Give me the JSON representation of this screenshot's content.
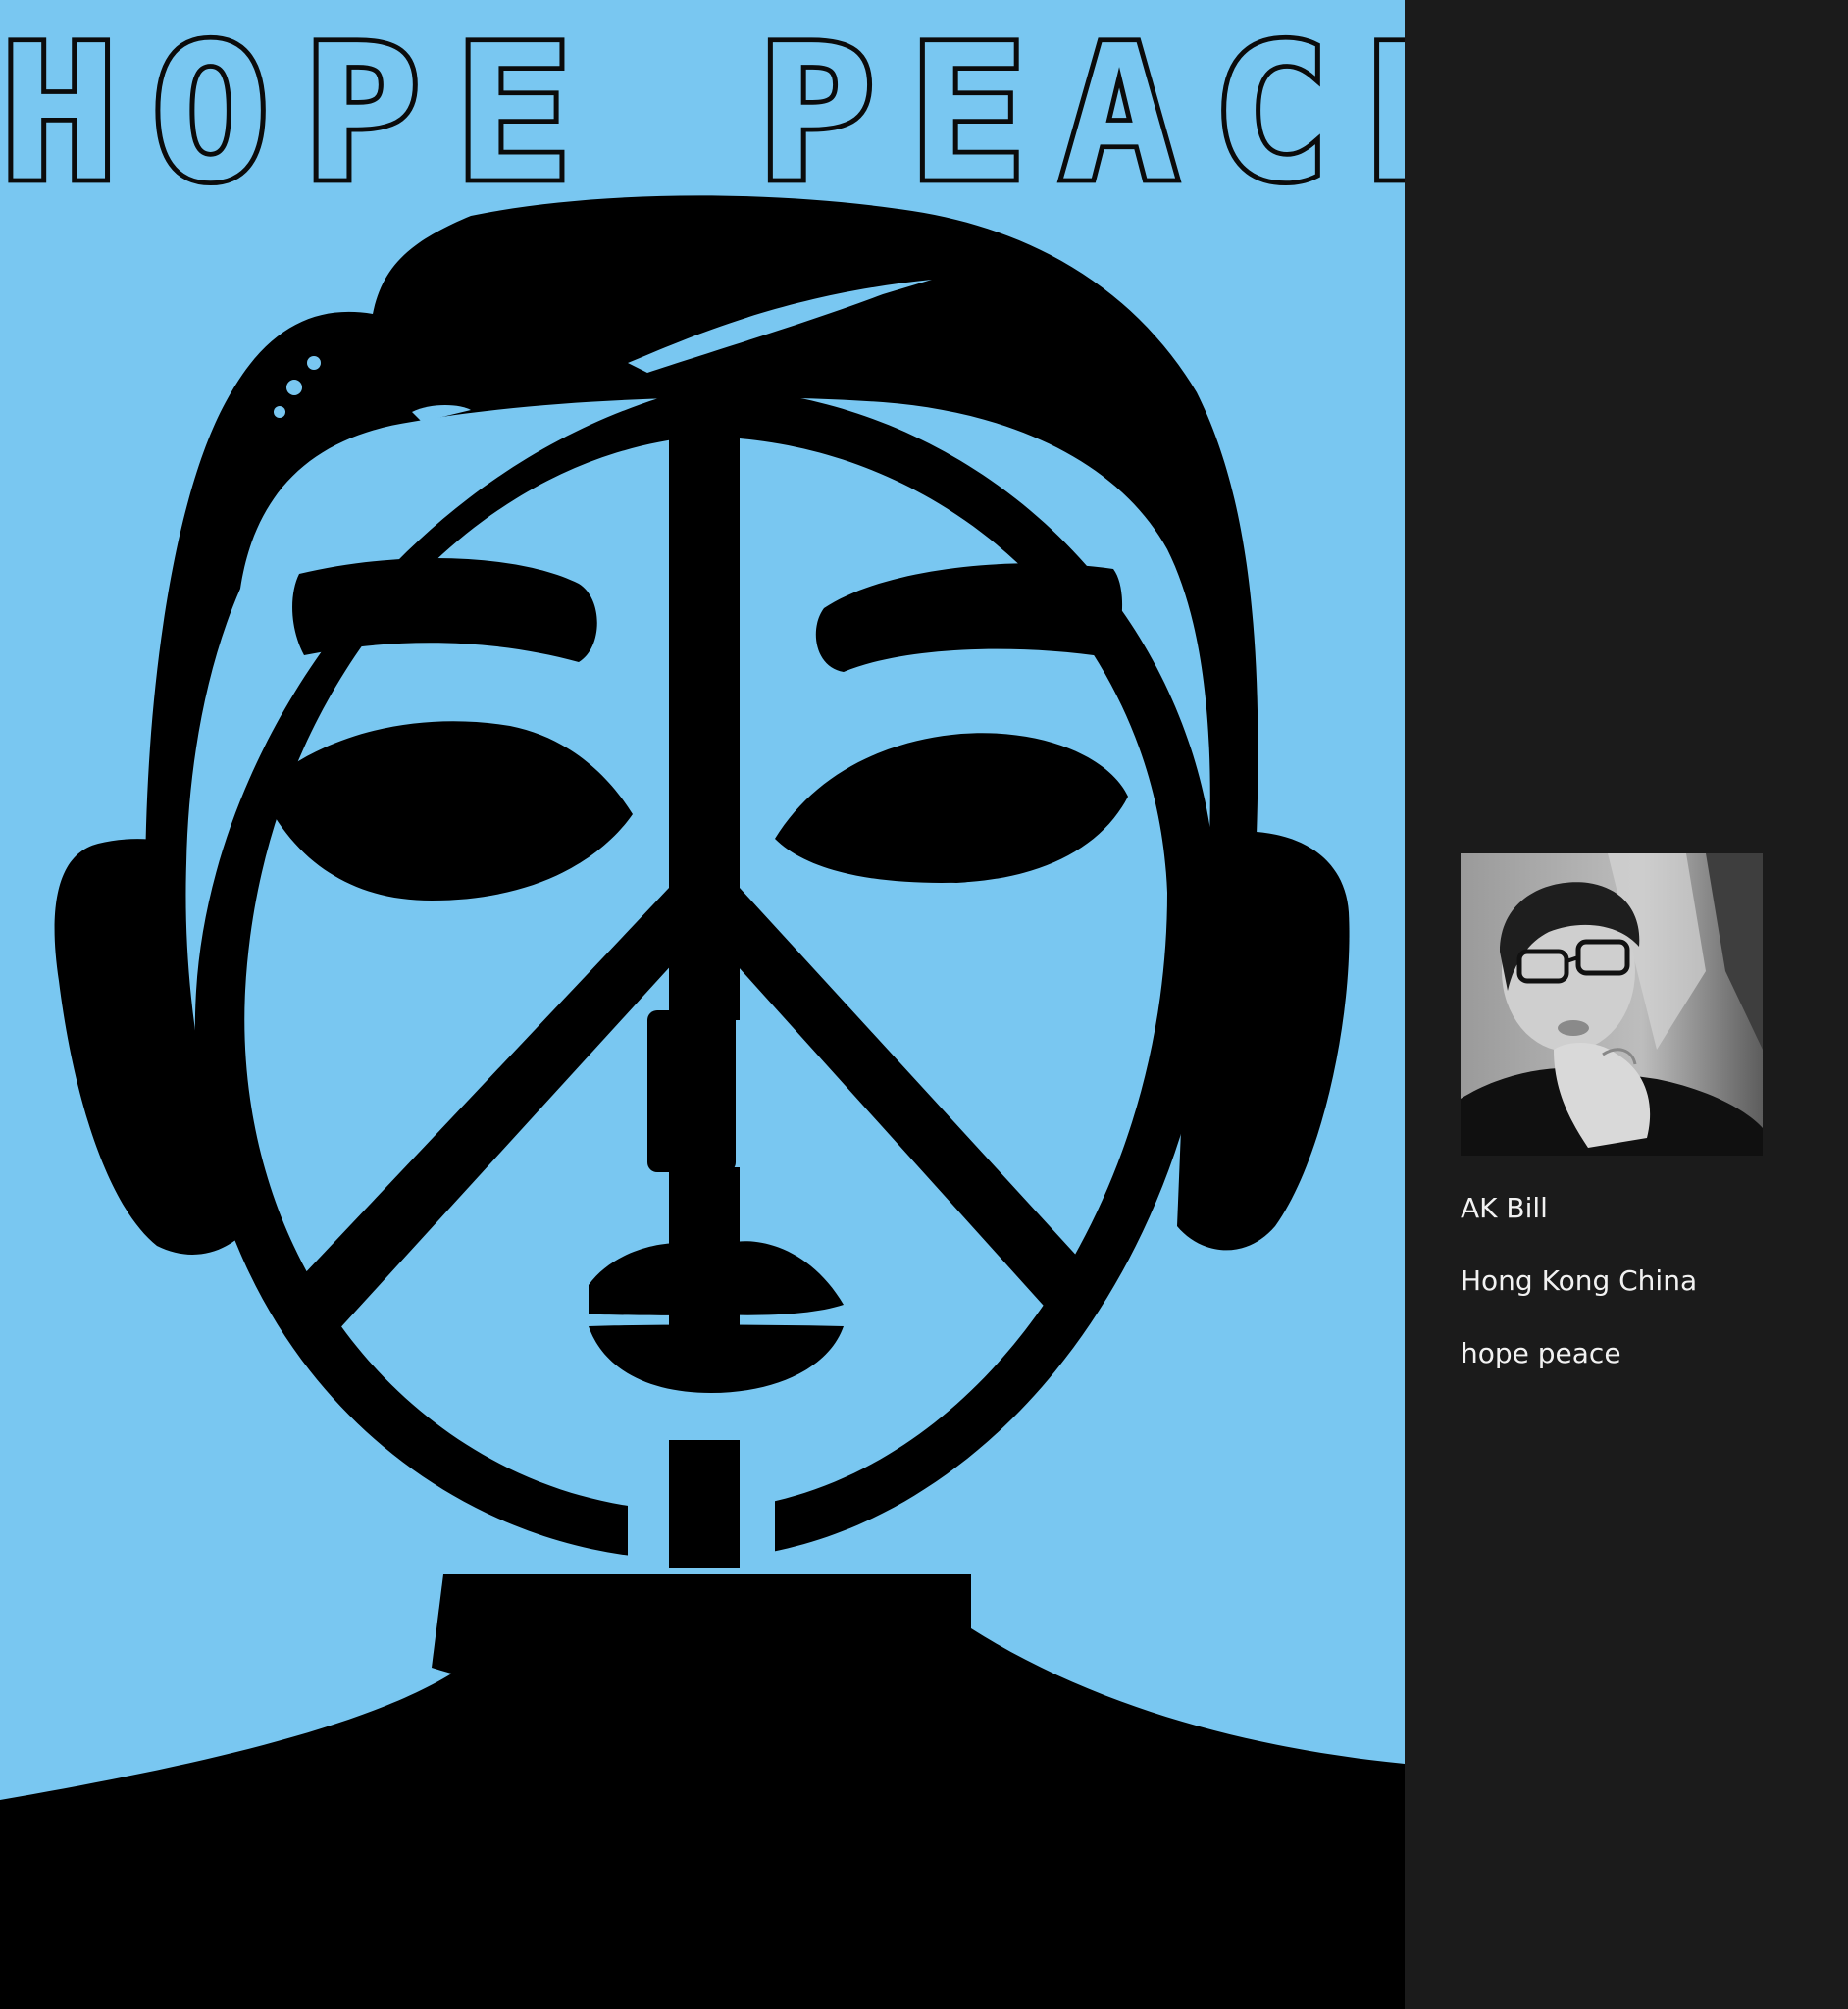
{
  "poster": {
    "title": "HOPE PEACE",
    "background_color": "#79c7f1",
    "ink_color": "#000000"
  },
  "artist": {
    "avatar_icon": "profile-photo",
    "name": "AK Bill",
    "location": "Hong Kong China",
    "artwork_title": "hope peace"
  },
  "panel": {
    "background_color": "#1b1b1b"
  }
}
